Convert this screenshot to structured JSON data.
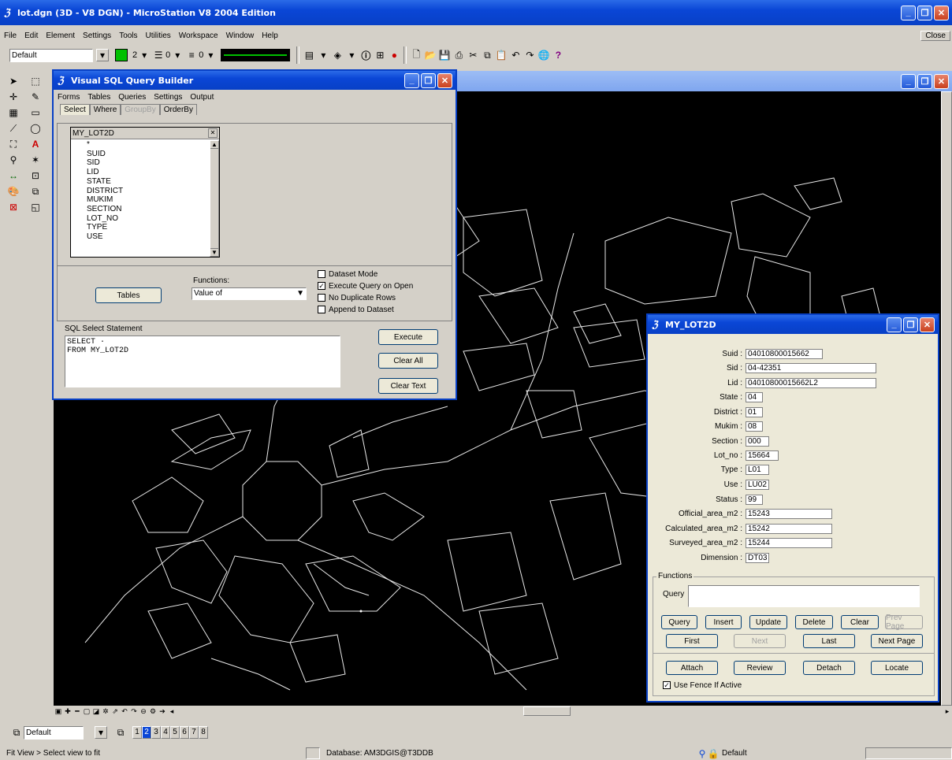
{
  "app": {
    "title": "lot.dgn (3D - V8 DGN) - MicroStation V8 2004 Edition",
    "close_tooltip": "Close",
    "menu": [
      "File",
      "Edit",
      "Element",
      "Settings",
      "Tools",
      "Utilities",
      "Workspace",
      "Window",
      "Help"
    ]
  },
  "attributes_toolbar": {
    "level": "Default",
    "color_num": "2",
    "style_num": "0",
    "weight_num": "0"
  },
  "sql_builder": {
    "title": "Visual SQL Query Builder",
    "menu": [
      "Forms",
      "Tables",
      "Queries",
      "Settings",
      "Output"
    ],
    "tabs": [
      "Select",
      "Where",
      "GroupBy",
      "OrderBy"
    ],
    "table_name": "MY_LOT2D",
    "columns": [
      "*",
      "SUID",
      "SID",
      "LID",
      "STATE",
      "DISTRICT",
      "MUKIM",
      "SECTION",
      "LOT_NO",
      "TYPE",
      "USE"
    ],
    "tables_button": "Tables",
    "functions_label": "Functions:",
    "functions_value": "Value of",
    "options": [
      {
        "label": "Dataset Mode",
        "checked": false
      },
      {
        "label": "Execute Query on Open",
        "checked": true
      },
      {
        "label": "No Duplicate Rows",
        "checked": false
      },
      {
        "label": "Append to Dataset",
        "checked": false
      }
    ],
    "sql_label": "SQL Select Statement",
    "sql_line1": "SELECT  ·",
    "sql_line2": "FROM  MY_LOT2D",
    "execute": "Execute",
    "clear_all": "Clear All",
    "clear_text": "Clear Text"
  },
  "form": {
    "title": "MY_LOT2D",
    "fields": [
      {
        "label": "Suid :",
        "value": "04010800015662"
      },
      {
        "label": "Sid :",
        "value": "04-42351"
      },
      {
        "label": "Lid :",
        "value": "04010800015662L2"
      },
      {
        "label": "State :",
        "value": "04"
      },
      {
        "label": "District :",
        "value": "01"
      },
      {
        "label": "Mukim :",
        "value": "08"
      },
      {
        "label": "Section :",
        "value": "000"
      },
      {
        "label": "Lot_no :",
        "value": "15664"
      },
      {
        "label": "Type :",
        "value": "L01"
      },
      {
        "label": "Use :",
        "value": "LU02"
      },
      {
        "label": "Status :",
        "value": "99"
      },
      {
        "label": "Official_area_m2 :",
        "value": "15243"
      },
      {
        "label": "Calculated_area_m2 :",
        "value": "15242"
      },
      {
        "label": "Surveyed_area_m2 :",
        "value": "15244"
      },
      {
        "label": "Dimension :",
        "value": "DT03"
      }
    ],
    "functions_label": "Functions",
    "query_label": "Query",
    "buttons_row1": [
      "Query",
      "Insert",
      "Update",
      "Delete",
      "Clear",
      "Prev Page"
    ],
    "buttons_row2": [
      "First",
      "Next",
      "Last",
      "Next Page"
    ],
    "buttons_row3": [
      "Attach",
      "Review",
      "Detach",
      "Locate"
    ],
    "fence_label": "Use Fence If Active"
  },
  "view_bar": {
    "level": "Default",
    "views": [
      "1",
      "2",
      "3",
      "4",
      "5",
      "6",
      "7",
      "8"
    ]
  },
  "status": {
    "prompt": "Fit View > Select view to fit",
    "database": "Database: AM3DGIS@T3DDB",
    "level": "Default"
  }
}
